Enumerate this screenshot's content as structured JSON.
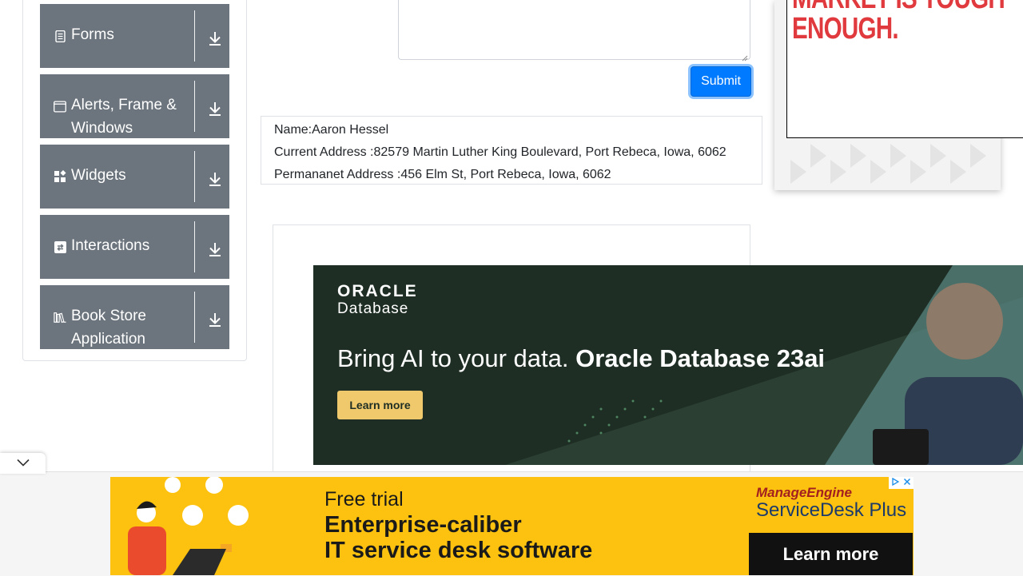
{
  "sidebar": {
    "groups": [
      {
        "label": "Forms",
        "icon": "form-icon"
      },
      {
        "label": "Alerts, Frame & Windows",
        "icon": "window-icon"
      },
      {
        "label": "Widgets",
        "icon": "widgets-icon"
      },
      {
        "label": "Interactions",
        "icon": "interactions-icon"
      },
      {
        "label": "Book Store Application",
        "icon": "book-icon"
      }
    ],
    "toggle_icon": "download-arrow-icon"
  },
  "form": {
    "submit_label": "Submit",
    "accent_color": "#007bff"
  },
  "output": {
    "name": "Name:Aaron Hessel",
    "current_address": "Current Address :82579 Martin Luther King Boulevard, Port Rebeca, Iowa, 6062",
    "permanent_address": "Permananet Address :456 Elm St, Port Rebeca, Iowa, 6062"
  },
  "right_ad": {
    "line1": "MARKET IS TOUGH",
    "line2": "ENOUGH."
  },
  "oracle_ad": {
    "brand": "ORACLE",
    "product": "Database",
    "tagline_regular": "Bring AI to your data. ",
    "tagline_bold": "Oracle Database 23ai",
    "cta": "Learn more",
    "bg_color": "#1e2e24",
    "cta_color": "#f0c96d"
  },
  "bottom_ad": {
    "line1": "Free trial",
    "line2": "Enterprise-caliber",
    "line3": "IT service desk software",
    "brand": "ManageEngine",
    "product": "ServiceDesk Plus",
    "cta": "Learn more",
    "bg_color": "#fcc20f"
  }
}
